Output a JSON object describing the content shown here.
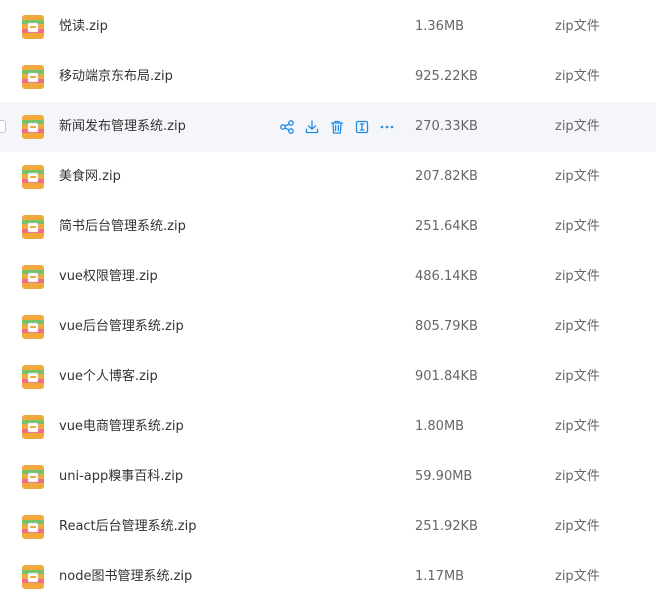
{
  "files": [
    {
      "name": "悦读.zip",
      "size": "1.36MB",
      "type": "zip文件"
    },
    {
      "name": "移动端京东布局.zip",
      "size": "925.22KB",
      "type": "zip文件"
    },
    {
      "name": "新闻发布管理系统.zip",
      "size": "270.33KB",
      "type": "zip文件"
    },
    {
      "name": "美食网.zip",
      "size": "207.82KB",
      "type": "zip文件"
    },
    {
      "name": "简书后台管理系统.zip",
      "size": "251.64KB",
      "type": "zip文件"
    },
    {
      "name": "vue权限管理.zip",
      "size": "486.14KB",
      "type": "zip文件"
    },
    {
      "name": "vue后台管理系统.zip",
      "size": "805.79KB",
      "type": "zip文件"
    },
    {
      "name": "vue个人博客.zip",
      "size": "901.84KB",
      "type": "zip文件"
    },
    {
      "name": "vue电商管理系统.zip",
      "size": "1.80MB",
      "type": "zip文件"
    },
    {
      "name": "uni-app糗事百科.zip",
      "size": "59.90MB",
      "type": "zip文件"
    },
    {
      "name": "React后台管理系统.zip",
      "size": "251.92KB",
      "type": "zip文件"
    },
    {
      "name": "node图书管理系统.zip",
      "size": "1.17MB",
      "type": "zip文件"
    }
  ],
  "row_actions": [
    "share-icon",
    "download-icon",
    "delete-icon",
    "rename-icon",
    "more-icon"
  ],
  "colors": {
    "accent": "#1e8ce6",
    "hover_row": "#f5f6fa",
    "zip_icon_bg": "#f0a93b",
    "zip_icon_stripe_green": "#74c26b",
    "zip_icon_stripe_pink": "#ef6b8a"
  }
}
